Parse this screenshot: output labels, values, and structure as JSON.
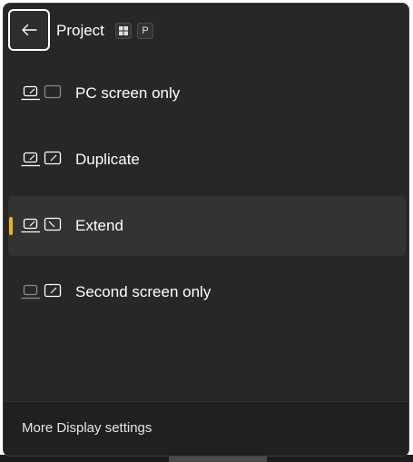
{
  "header": {
    "title": "Project",
    "shortcut_key": "P",
    "back_icon": "arrow-left-icon",
    "windows_icon": "windows-logo-icon"
  },
  "options": [
    {
      "label": "PC screen only",
      "icon": "pc-screen-only-icon",
      "selected": false
    },
    {
      "label": "Duplicate",
      "icon": "duplicate-icon",
      "selected": false
    },
    {
      "label": "Extend",
      "icon": "extend-icon",
      "selected": true
    },
    {
      "label": "Second screen only",
      "icon": "second-screen-only-icon",
      "selected": false
    }
  ],
  "footer": {
    "link": "More Display settings"
  },
  "colors": {
    "panel_bg": "#272727",
    "footer_bg": "#202020",
    "selected_bg": "#333333",
    "accent": "#f4b400",
    "text": "#ffffff"
  }
}
